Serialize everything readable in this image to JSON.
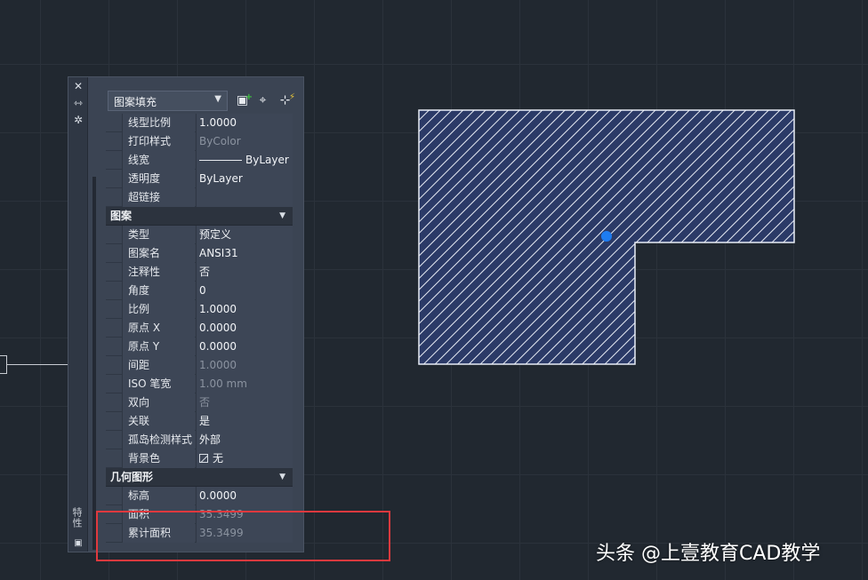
{
  "palette": {
    "title": "特性",
    "selector_value": "图案填充",
    "sections": [
      {
        "header": "",
        "rows": [
          {
            "label": "线型比例",
            "value": "1.0000",
            "dim": false
          },
          {
            "label": "打印样式",
            "value": "ByColor",
            "dim": true
          },
          {
            "label": "线宽",
            "value": "ByLayer",
            "dim": false,
            "lineweight": true
          },
          {
            "label": "透明度",
            "value": "ByLayer",
            "dim": false
          },
          {
            "label": "超链接",
            "value": "",
            "dim": false
          }
        ]
      },
      {
        "header": "图案",
        "rows": [
          {
            "label": "类型",
            "value": "预定义",
            "dim": false
          },
          {
            "label": "图案名",
            "value": "ANSI31",
            "dim": false
          },
          {
            "label": "注释性",
            "value": "否",
            "dim": false
          },
          {
            "label": "角度",
            "value": "0",
            "dim": false
          },
          {
            "label": "比例",
            "value": "1.0000",
            "dim": false
          },
          {
            "label": "原点 X",
            "value": "0.0000",
            "dim": false
          },
          {
            "label": "原点 Y",
            "value": "0.0000",
            "dim": false
          },
          {
            "label": "间距",
            "value": "1.0000",
            "dim": true
          },
          {
            "label": "ISO 笔宽",
            "value": "1.00 mm",
            "dim": true
          },
          {
            "label": "双向",
            "value": "否",
            "dim": true
          },
          {
            "label": "关联",
            "value": "是",
            "dim": false
          },
          {
            "label": "孤岛检测样式",
            "value": "外部",
            "dim": false
          },
          {
            "label": "背景色",
            "value": "无",
            "dim": false,
            "swatch": true
          }
        ]
      },
      {
        "header": "几何图形",
        "rows": [
          {
            "label": "标高",
            "value": "0.0000",
            "dim": false
          },
          {
            "label": "面积",
            "value": "35.3499",
            "dim": true
          },
          {
            "label": "累计面积",
            "value": "35.3499",
            "dim": true
          }
        ]
      }
    ]
  },
  "icons": {
    "close": "close-icon",
    "autohide": "autohide-icon",
    "settings": "settings-icon",
    "quick_select": "quick-select-icon",
    "select_objects": "select-objects-icon",
    "toggle_pickadd": "toggle-pickadd-icon"
  },
  "colors": {
    "hatch_fill": "#2b3a67",
    "hatch_lines": "#e8ecf5",
    "grip": "#1d7cf2",
    "highlight": "#e0393e"
  },
  "watermark": "头条 @上壹教育CAD教学"
}
